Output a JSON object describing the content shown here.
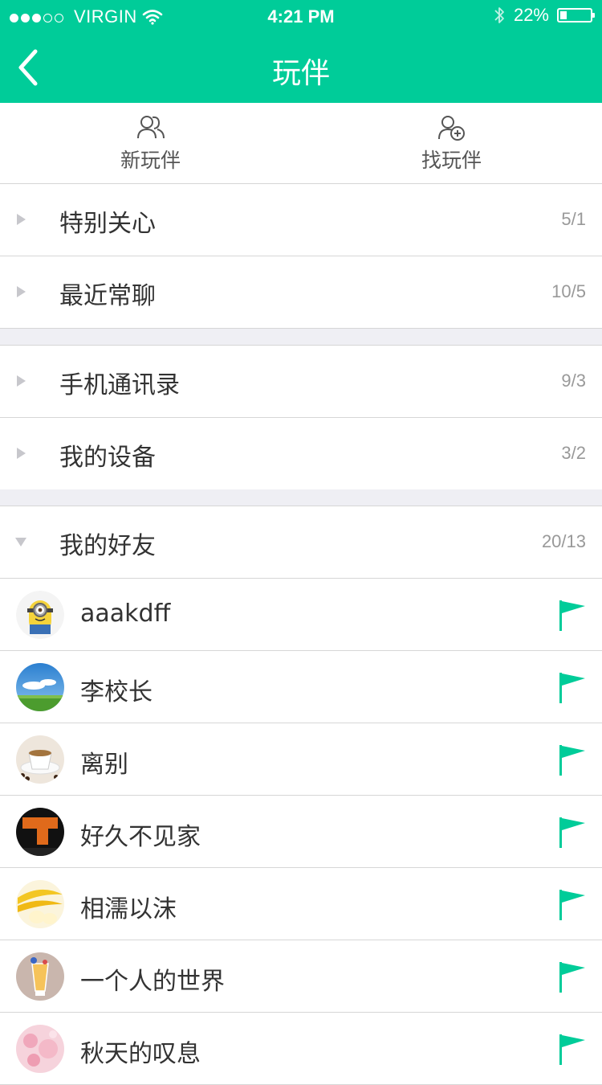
{
  "status_bar": {
    "carrier": "VIRGIN",
    "time": "4:21 PM",
    "battery_percent": "22%",
    "signal_filled": 3,
    "signal_total": 5
  },
  "nav": {
    "title": "玩伴",
    "back_icon": "chevron-left-icon"
  },
  "tabs": {
    "new_partner": "新玩伴",
    "find_partner": "找玩伴"
  },
  "groups": [
    {
      "label": "特别关心",
      "count": "5/1"
    },
    {
      "label": "最近常聊",
      "count": "10/5"
    },
    {
      "label": "手机通讯录",
      "count": "9/3"
    },
    {
      "label": "我的设备",
      "count": "3/2"
    },
    {
      "label": "我的好友",
      "count": "20/13",
      "expanded": true
    }
  ],
  "friends": [
    {
      "name": "aaakdff",
      "avatar": "minion-avatar"
    },
    {
      "name": "李校长",
      "avatar": "sky-field-avatar"
    },
    {
      "name": "离别",
      "avatar": "coffee-cup-avatar"
    },
    {
      "name": "好久不见家",
      "avatar": "orange-logo-avatar"
    },
    {
      "name": "相濡以沫",
      "avatar": "banana-avatar"
    },
    {
      "name": "一个人的世界",
      "avatar": "drink-glass-avatar"
    },
    {
      "name": "秋天的叹息",
      "avatar": "pink-flower-avatar"
    }
  ],
  "colors": {
    "accent": "#00cc99",
    "flag": "#00cc99"
  }
}
